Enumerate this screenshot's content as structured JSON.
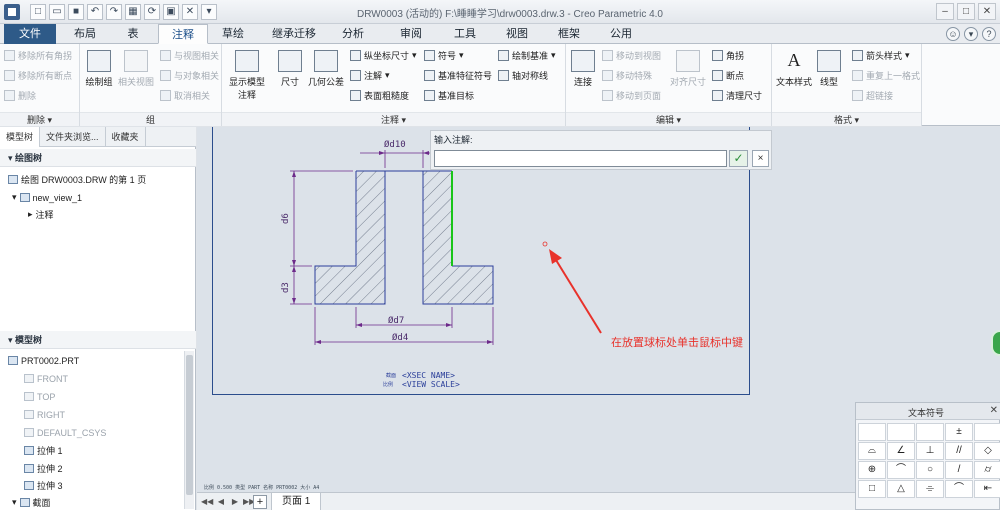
{
  "window": {
    "title": "DRW0003 (活动的) F:\\睡睡学习\\drw0003.drw.3 - Creo Parametric 4.0"
  },
  "tabs": [
    {
      "label": "文件",
      "state": "file"
    },
    {
      "label": "布局"
    },
    {
      "label": "表"
    },
    {
      "label": "注释",
      "state": "active"
    },
    {
      "label": "草绘"
    },
    {
      "label": "继承迁移"
    },
    {
      "label": "分析"
    },
    {
      "label": "审阅"
    },
    {
      "label": "工具"
    },
    {
      "label": "视图"
    },
    {
      "label": "框架"
    },
    {
      "label": "公用"
    }
  ],
  "ribbon": {
    "delete_group": {
      "label": "删除",
      "items": [
        "移除所有角拐",
        "移除所有断点",
        "删除"
      ]
    },
    "group_group": {
      "label": "组",
      "big": [
        "绘制组",
        "相关视图"
      ],
      "items": [
        "与视图相关",
        "与对象相关",
        "取消相关"
      ]
    },
    "annotate_group": {
      "label": "注释",
      "big": [
        "显示模型注释",
        "尺寸",
        "几何公差"
      ],
      "items": [
        "纵坐标尺寸",
        "注解",
        "表面粗糙度",
        "符号",
        "基准特征符号",
        "基准目标",
        "绘制基准",
        "轴对称线"
      ]
    },
    "edit_group": {
      "label": "编辑",
      "big": [
        "连接",
        "对齐尺寸"
      ],
      "items": [
        "移动到视图",
        "移动特殊",
        "移动到页面",
        "角拐",
        "断点",
        "清理尺寸"
      ]
    },
    "format_group": {
      "label": "格式",
      "big": [
        "文本样式",
        "线型"
      ],
      "items": [
        "箭头样式",
        "重复上一格式",
        "超链接"
      ]
    }
  },
  "left_panel": {
    "tabs": [
      "模型树",
      "文件夹浏览...",
      "收藏夹"
    ],
    "drawing_tree": {
      "title": "绘图树",
      "nodes": [
        "绘图 DRW0003.DRW 的第 1 页",
        "new_view_1",
        "注释"
      ]
    },
    "model_tree": {
      "title": "模型树",
      "nodes": [
        {
          "label": "PRT0002.PRT",
          "gray": false
        },
        {
          "label": "FRONT",
          "gray": true
        },
        {
          "label": "TOP",
          "gray": true
        },
        {
          "label": "RIGHT",
          "gray": true
        },
        {
          "label": "DEFAULT_CSYS",
          "gray": true
        },
        {
          "label": "拉伸 1",
          "gray": false
        },
        {
          "label": "拉伸 2",
          "gray": false
        },
        {
          "label": "拉伸 3",
          "gray": false
        },
        {
          "label": "截面",
          "gray": false
        }
      ]
    }
  },
  "note_dialog": {
    "label": "输入注解:",
    "value": "",
    "ok_symbol": "✓",
    "cancel_symbol": "×"
  },
  "drawing": {
    "dims": {
      "d10": "Ød10",
      "d6": "d6",
      "d3": "d3",
      "d7": "Ød7",
      "d4": "Ød4"
    },
    "view_labels": {
      "name_prefix": "截面",
      "name_value": "<XSEC NAME>",
      "scale_prefix": "比例",
      "scale_value": "<VIEW SCALE>"
    }
  },
  "annotation": {
    "text": "在放置球标处单击鼠标中键",
    "color": "#e8322b"
  },
  "status": {
    "scale_line": "比例 0.500   类型 PART   名称 PRT0002   大小 A4",
    "page_tab": "页面 1"
  },
  "symbol_palette": {
    "title": "文本符号",
    "symbols": [
      "",
      "",
      "",
      "±",
      "",
      "⌓",
      "∠",
      "⊥",
      "//",
      "◇",
      "⊕",
      "⌒",
      "○",
      "/",
      "⌭",
      "□",
      "△",
      "⌯",
      "⌒",
      "⇤",
      "⌖",
      "⌀",
      "□",
      "Ⓟ",
      "₵"
    ]
  },
  "colors": {
    "file_tab": "#2e5a88",
    "geometry_line": "#2b3f9a",
    "highlight_edge": "#19c519",
    "sheet_border": "#2b4d8c"
  }
}
